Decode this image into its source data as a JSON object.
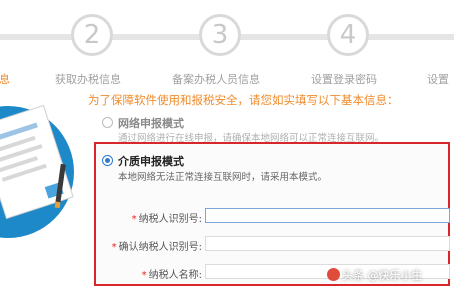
{
  "steps": [
    {
      "number": "",
      "label": "息",
      "active": true
    },
    {
      "number": "2",
      "label": "获取办税信息"
    },
    {
      "number": "3",
      "label": "备案办税人员信息"
    },
    {
      "number": "4",
      "label": "设置登录密码"
    },
    {
      "number": "",
      "label": "设置"
    }
  ],
  "notice": "为了保障软件使用和报税安全，请您如实填写以下基本信息：",
  "modes": {
    "network": {
      "title": "网络申报模式",
      "description": "通过网络进行在线申报，请确保本地网络可以正常连接互联网。"
    },
    "media": {
      "title": "介质申报模式",
      "description": "本地网络无法正常连接互联网时，请采用本模式。"
    }
  },
  "form": {
    "required_mark": "*",
    "taxpayer_id_label": "纳税人识别号:",
    "taxpayer_id_value": "",
    "confirm_id_label": "确认纳税人识别号:",
    "confirm_id_value": "",
    "taxpayer_name_label": "纳税人名称:",
    "taxpayer_name_value": ""
  },
  "watermark": "头条 @快乐小生",
  "colors": {
    "accent_orange": "#f08b2c",
    "highlight_red": "#d9262a",
    "radio_blue": "#2e7ad1",
    "illustration_blue": "#1e89c8"
  }
}
